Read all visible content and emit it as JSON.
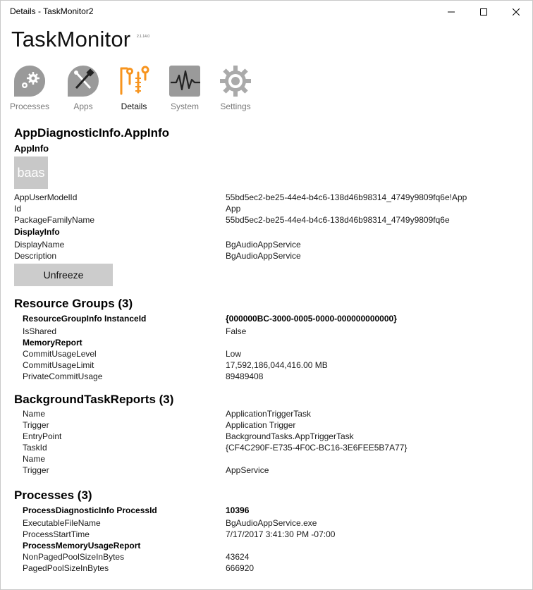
{
  "window": {
    "title": "Details - TaskMonitor2"
  },
  "app": {
    "name": "TaskMonitor",
    "version": "2.1.14.0"
  },
  "nav": {
    "items": [
      {
        "label": "Processes"
      },
      {
        "label": "Apps"
      },
      {
        "label": "Details"
      },
      {
        "label": "System"
      },
      {
        "label": "Settings"
      }
    ],
    "active": "Details",
    "accent": "#f7941e"
  },
  "appdiag": {
    "title": "AppDiagnosticInfo.AppInfo",
    "subtitle": "AppInfo",
    "logo_text": "baas",
    "fields": [
      {
        "key": "AppUserModelId",
        "value": "55bd5ec2-be25-44e4-b4c6-138d46b98314_4749y9809fq6e!App"
      },
      {
        "key": "Id",
        "value": "App"
      },
      {
        "key": "PackageFamilyName",
        "value": "55bd5ec2-be25-44e4-b4c6-138d46b98314_4749y9809fq6e"
      }
    ],
    "display_header": "DisplayInfo",
    "display_fields": [
      {
        "key": "DisplayName",
        "value": "BgAudioAppService"
      },
      {
        "key": "Description",
        "value": "BgAudioAppService"
      }
    ],
    "button": "Unfreeze"
  },
  "resource_groups": {
    "title": "Resource Groups (3)",
    "instance_key": "ResourceGroupInfo InstanceId",
    "instance_value": "{000000BC-3000-0005-0000-000000000000}",
    "is_shared_key": "IsShared",
    "is_shared_value": "False",
    "memory_header": "MemoryReport",
    "memory_fields": [
      {
        "key": "CommitUsageLevel",
        "value": "Low"
      },
      {
        "key": "CommitUsageLimit",
        "value": "17,592,186,044,416.00 MB"
      },
      {
        "key": "PrivateCommitUsage",
        "value": "89489408"
      }
    ]
  },
  "background_tasks": {
    "title": "BackgroundTaskReports (3)",
    "fields": [
      {
        "key": "Name",
        "value": "ApplicationTriggerTask"
      },
      {
        "key": "Trigger",
        "value": "Application Trigger"
      },
      {
        "key": "EntryPoint",
        "value": "BackgroundTasks.AppTriggerTask"
      },
      {
        "key": "TaskId",
        "value": "{CF4C290F-E735-4F0C-BC16-3E6FEE5B7A77}"
      },
      {
        "key": "Name",
        "value": ""
      },
      {
        "key": "Trigger",
        "value": "AppService"
      }
    ]
  },
  "processes": {
    "title": "Processes (3)",
    "pid_key": "ProcessDiagnosticInfo ProcessId",
    "pid_value": "10396",
    "fields": [
      {
        "key": "ExecutableFileName",
        "value": "BgAudioAppService.exe"
      },
      {
        "key": "ProcessStartTime",
        "value": "7/17/2017 3:41:30 PM -07:00"
      }
    ],
    "memory_header": "ProcessMemoryUsageReport",
    "memory_fields": [
      {
        "key": "NonPagedPoolSizeInBytes",
        "value": "43624"
      },
      {
        "key": "PagedPoolSizeInBytes",
        "value": "666920"
      }
    ]
  }
}
